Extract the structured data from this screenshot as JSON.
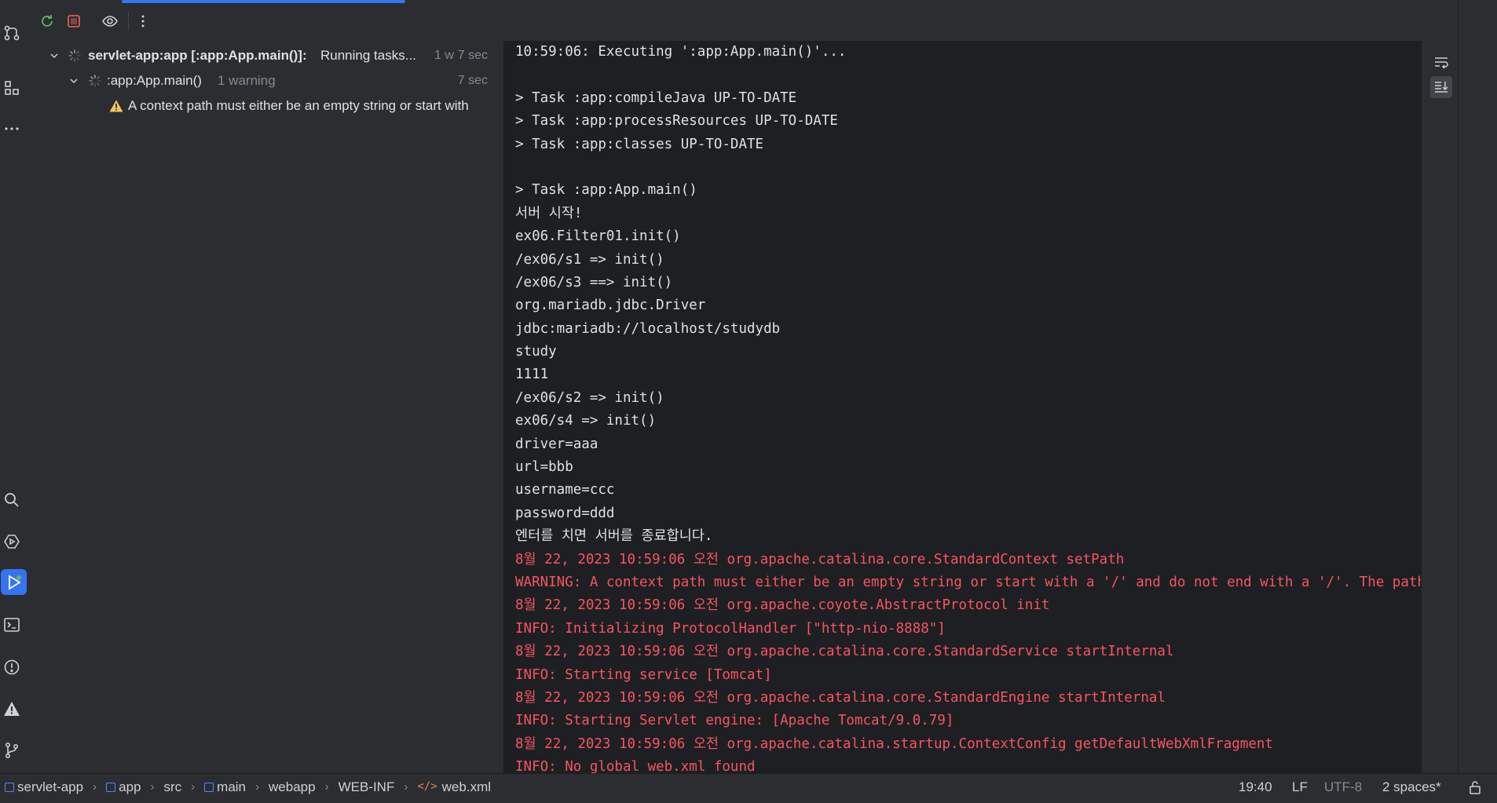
{
  "toolbar": {
    "rerun_icon": "rerun-icon",
    "stop_icon": "stop-icon",
    "view_icon": "eye-icon",
    "more_icon": "more-vertical-icon"
  },
  "left_tools": {
    "top": [
      "commit-icon",
      "structure-icon",
      "more-horizontal-icon"
    ],
    "bottom": [
      "find-icon",
      "services-icon",
      "run-icon",
      "terminal-icon",
      "problems-icon",
      "warning-icon",
      "git-icon"
    ]
  },
  "tree": {
    "root": {
      "label": "servlet-app:app [:app:App.main()]:",
      "status": "Running tasks...",
      "warnings_short": "1 w",
      "time": "7 sec"
    },
    "child": {
      "label": ":app:App.main()",
      "note": "1 warning",
      "time": "7 sec"
    },
    "warning": {
      "text": "A context path must either be an empty string or start with"
    }
  },
  "console": {
    "lines": [
      {
        "text": "10:59:06: Executing ':app:App.main()'...",
        "kind": "out"
      },
      {
        "text": "",
        "kind": "out"
      },
      {
        "text": "> Task :app:compileJava UP-TO-DATE",
        "kind": "out"
      },
      {
        "text": "> Task :app:processResources UP-TO-DATE",
        "kind": "out"
      },
      {
        "text": "> Task :app:classes UP-TO-DATE",
        "kind": "out"
      },
      {
        "text": "",
        "kind": "out"
      },
      {
        "text": "> Task :app:App.main()",
        "kind": "out"
      },
      {
        "text": "서버 시작!",
        "kind": "out"
      },
      {
        "text": "ex06.Filter01.init()",
        "kind": "out"
      },
      {
        "text": "/ex06/s1 => init()",
        "kind": "out"
      },
      {
        "text": "/ex06/s3 ==> init()",
        "kind": "out"
      },
      {
        "text": "org.mariadb.jdbc.Driver",
        "kind": "out"
      },
      {
        "text": "jdbc:mariadb://localhost/studydb",
        "kind": "out"
      },
      {
        "text": "study",
        "kind": "out"
      },
      {
        "text": "1111",
        "kind": "out"
      },
      {
        "text": "/ex06/s2 => init()",
        "kind": "out"
      },
      {
        "text": "ex06/s4 => init()",
        "kind": "out"
      },
      {
        "text": "driver=aaa",
        "kind": "out"
      },
      {
        "text": "url=bbb",
        "kind": "out"
      },
      {
        "text": "username=ccc",
        "kind": "out"
      },
      {
        "text": "password=ddd",
        "kind": "out"
      },
      {
        "text": "엔터를 치면 서버를 종료합니다.",
        "kind": "out"
      },
      {
        "text": "8월 22, 2023 10:59:06 오전 org.apache.catalina.core.StandardContext setPath",
        "kind": "err"
      },
      {
        "text": "WARNING: A context path must either be an empty string or start with a '/' and do not end with a '/'. The path [/] d",
        "kind": "err"
      },
      {
        "text": "8월 22, 2023 10:59:06 오전 org.apache.coyote.AbstractProtocol init",
        "kind": "err"
      },
      {
        "text": "INFO: Initializing ProtocolHandler [\"http-nio-8888\"]",
        "kind": "err"
      },
      {
        "text": "8월 22, 2023 10:59:06 오전 org.apache.catalina.core.StandardService startInternal",
        "kind": "err"
      },
      {
        "text": "INFO: Starting service [Tomcat]",
        "kind": "err"
      },
      {
        "text": "8월 22, 2023 10:59:06 오전 org.apache.catalina.core.StandardEngine startInternal",
        "kind": "err"
      },
      {
        "text": "INFO: Starting Servlet engine: [Apache Tomcat/9.0.79]",
        "kind": "err"
      },
      {
        "text": "8월 22, 2023 10:59:06 오전 org.apache.catalina.startup.ContextConfig getDefaultWebXmlFragment",
        "kind": "err"
      },
      {
        "text": "INFO: No global web.xml found",
        "kind": "err"
      }
    ]
  },
  "console_gutter": {
    "soft_wrap_icon": "soft-wrap-icon",
    "scroll_to_end_icon": "scroll-to-end-icon"
  },
  "statusbar": {
    "breadcrumbs": [
      "servlet-app",
      "app",
      "src",
      "main",
      "webapp",
      "WEB-INF",
      "web.xml"
    ],
    "position": "19:40",
    "line_sep": "LF",
    "encoding": "UTF-8",
    "indent": "2 spaces*"
  },
  "colors": {
    "accent": "#3574f0",
    "error_text": "#f75464",
    "warning": "#f2c55c",
    "stop": "#db5c5c",
    "rerun": "#5fb865"
  }
}
